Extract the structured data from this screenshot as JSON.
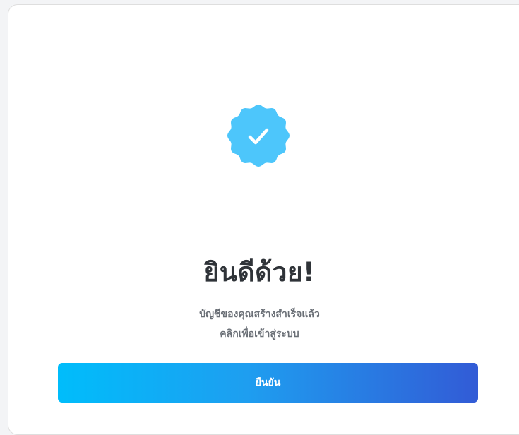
{
  "dialog": {
    "title": "ยินดีด้วย!",
    "message_line1": "บัญชีของคุณสร้างสำเร็จแล้ว",
    "message_line2": "คลิกเพื่อเข้าสู่ระบบ",
    "confirm_label": "ยืนยัน"
  },
  "icons": {
    "success": "verified-badge-check-icon"
  },
  "colors": {
    "badge": "#4dc6fb",
    "check": "#ffffff",
    "button_gradient_start": "#00bdfb",
    "button_gradient_end": "#325bd6",
    "title_text": "#2f3338",
    "message_text": "#6a6f76"
  }
}
